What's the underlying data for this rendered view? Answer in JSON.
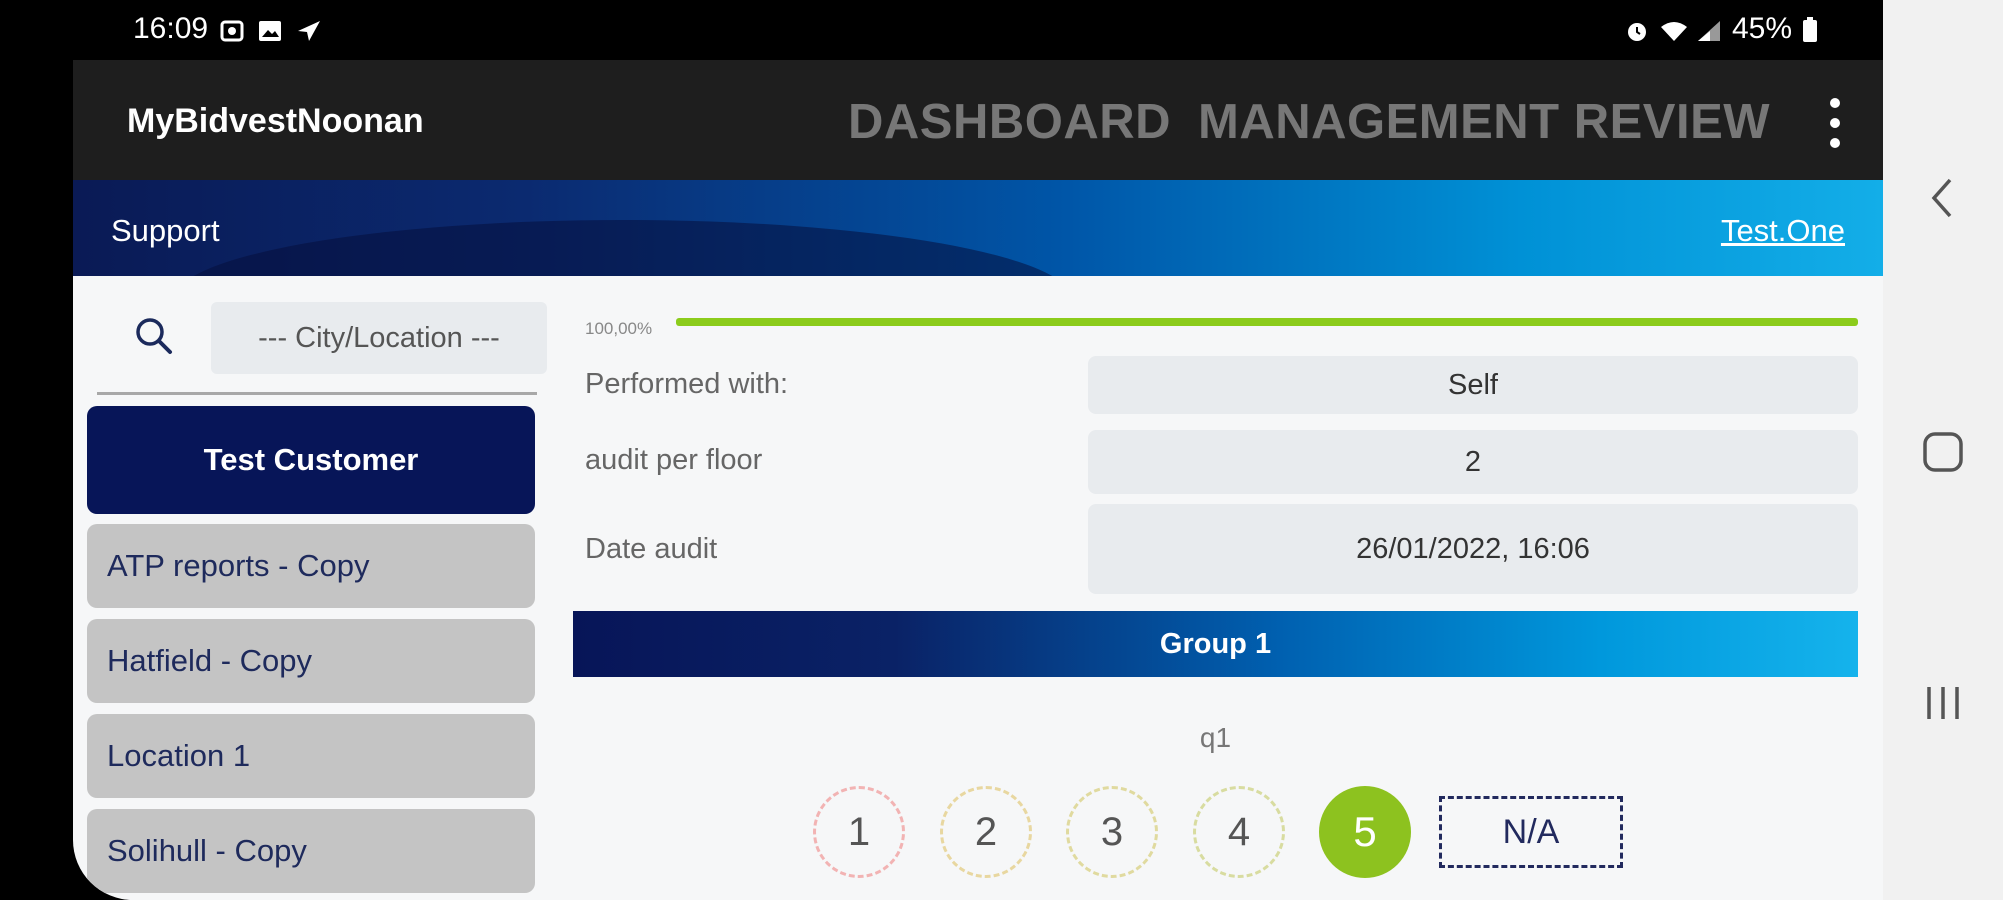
{
  "status_bar": {
    "time": "16:09",
    "left_icons": [
      "sim-card-icon",
      "image-icon",
      "navigation-icon"
    ],
    "right_icons": [
      "alarm-icon",
      "wifi-icon",
      "signal-icon"
    ],
    "battery": "45%"
  },
  "app_bar": {
    "title": "MyBidvestNoonan",
    "tabs": [
      {
        "label": "DASHBOARD"
      },
      {
        "label": "MANAGEMENT REVIEW"
      }
    ],
    "overflow_icon": "more-vert-icon"
  },
  "banner": {
    "section": "Support",
    "user": "Test.One"
  },
  "sidebar": {
    "search_icon": "search-icon",
    "city_placeholder": "--- City/Location ---",
    "items": [
      {
        "label": "Test Customer",
        "active": true
      },
      {
        "label": "ATP reports - Copy"
      },
      {
        "label": "Hatfield - Copy"
      },
      {
        "label": "Location 1"
      },
      {
        "label": "Solihull - Copy"
      }
    ]
  },
  "main": {
    "progress": {
      "label": "100,00%",
      "value": 1.0
    },
    "fields": [
      {
        "label": "Performed with:",
        "value": "Self"
      },
      {
        "label": "audit per floor",
        "value": "2"
      },
      {
        "label": "Date audit",
        "value": "26/01/2022, 16:06"
      }
    ],
    "group": {
      "title": "Group 1",
      "question": "q1",
      "ratings": [
        "1",
        "2",
        "3",
        "4",
        "5"
      ],
      "selected_rating": "5",
      "na_label": "N/A"
    }
  },
  "colors": {
    "navy": "#071558",
    "accent_green": "#8dc21f",
    "banner_light": "#13aee8"
  },
  "system_nav": [
    "back-icon",
    "home-icon",
    "recents-icon"
  ]
}
